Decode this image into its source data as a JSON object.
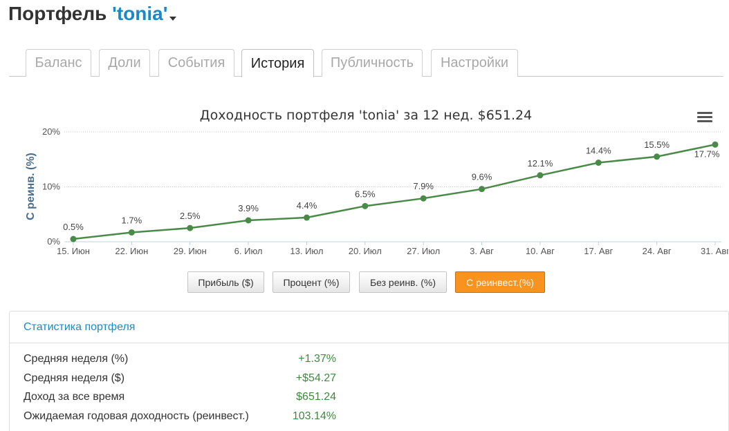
{
  "header": {
    "title_prefix": "Портфель ",
    "portfolio_name": "'tonia'"
  },
  "tabs": [
    {
      "label": "Баланс",
      "active": false
    },
    {
      "label": "Доли",
      "active": false
    },
    {
      "label": "События",
      "active": false
    },
    {
      "label": "История",
      "active": true
    },
    {
      "label": "Публичность",
      "active": false
    },
    {
      "label": "Настройки",
      "active": false
    }
  ],
  "chart_data": {
    "type": "line",
    "title": "Доходность портфеля 'tonia' за 12 нед. $651.24",
    "ylabel": "С реинв. (%)",
    "xlabel": "",
    "categories": [
      "15. Июн",
      "22. Июн",
      "29. Июн",
      "6. Июл",
      "13. Июл",
      "20. Июл",
      "27. Июл",
      "3. Авг",
      "10. Авг",
      "17. Авг",
      "24. Авг",
      "31. Авг"
    ],
    "series": [
      {
        "values": [
          0.5,
          1.7,
          2.5,
          3.9,
          4.4,
          6.5,
          7.9,
          9.6,
          12.1,
          14.4,
          15.5,
          17.7
        ],
        "color": "#4a8a48"
      }
    ],
    "data_labels": [
      "0.5%",
      "1.7%",
      "2.5%",
      "3.9%",
      "4.4%",
      "6.5%",
      "7.9%",
      "9.6%",
      "12.1%",
      "14.4%",
      "15.5%",
      "17.7%"
    ],
    "yticks": [
      "0%",
      "10%",
      "20%"
    ],
    "ylim": [
      0,
      20
    ],
    "grid": true,
    "legend": "none"
  },
  "chart_menu_icon": "hamburger-menu-icon",
  "chart_buttons": [
    {
      "label": "Прибыль ($)",
      "active": false
    },
    {
      "label": "Процент (%)",
      "active": false
    },
    {
      "label": "Без реинв. (%)",
      "active": false
    },
    {
      "label": "С реинвест.(%)",
      "active": true
    }
  ],
  "stats": {
    "title": "Статистика портфеля",
    "rows": [
      {
        "label": "Средняя неделя (%)",
        "value": "+1.37%"
      },
      {
        "label": "Средняя неделя ($)",
        "value": "+$54.27"
      },
      {
        "label": "Доход за все время",
        "value": "$651.24"
      },
      {
        "label": "Ожидаемая годовая доходность (реинвест.)",
        "value": "103.14%"
      }
    ]
  },
  "colors": {
    "accent_blue": "#1a8ac6",
    "line_green": "#4a8a48",
    "value_green": "#3d8a3d",
    "active_orange": "#f7931e"
  }
}
